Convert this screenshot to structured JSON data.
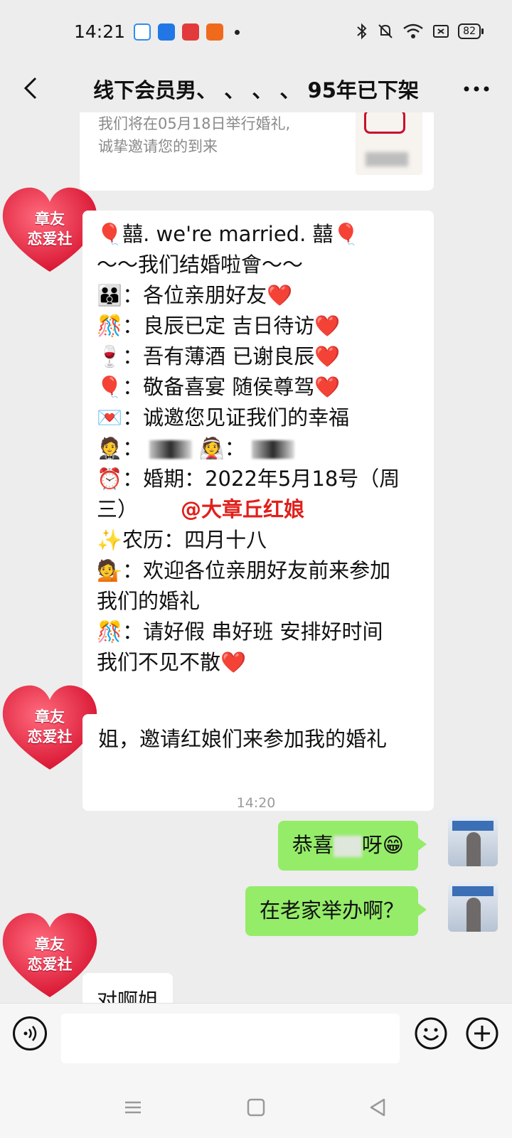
{
  "status": {
    "time": "14:21",
    "battery": "82"
  },
  "header": {
    "title": "线下会员男、 、 、 、 95年已下架"
  },
  "card": {
    "line1": "我们将在05月18日举行婚礼,",
    "line2": "诚挚邀请您的到来"
  },
  "avatar_text": {
    "line1": "章友",
    "line2": "恋爱社"
  },
  "invitation": {
    "lines": [
      "🎈囍. we're married. 囍🎈",
      "～～我们结婚啦會～～",
      "👪：各位亲朋好友❤️",
      "🎊：良辰已定 吉日待访❤️",
      "🍷：吾有薄酒 已谢良辰❤️",
      "🎈：敬备喜宴 随侯尊驾❤️",
      "💌：诚邀您见证我们的幸福"
    ],
    "groom_bride": {
      "groom_emoji": "🤵",
      "bride_emoji": "👰",
      "sep": "："
    },
    "date_line": "⏰：婚期：2022年5月18号（周",
    "date_line2": "三）",
    "mention": "@大章丘红娘",
    "lines2": [
      "✨农历：四月十八",
      "💁：欢迎各位亲朋好友前来参加",
      "我们的婚礼",
      "🎊：请好假 串好班 安排好时间",
      "我们不见不散❤️"
    ]
  },
  "messages": {
    "msg_invite": "姐，邀请红娘们来参加我的婚礼",
    "timestamp": "14:20",
    "msg_congrats_prefix": "恭喜",
    "msg_congrats_suffix": "呀😁",
    "msg_hometown": "在老家举办啊？",
    "msg_reply": "对啊姐"
  },
  "colors": {
    "accent_green": "#95ec69",
    "mention_red": "#e0201b",
    "avatar_red": "#e8243b"
  },
  "icons": [
    "back-arrow-icon",
    "more-icon",
    "voice-icon",
    "emoji-icon",
    "plus-icon",
    "menu-icon",
    "home-icon",
    "back-triangle-icon"
  ]
}
